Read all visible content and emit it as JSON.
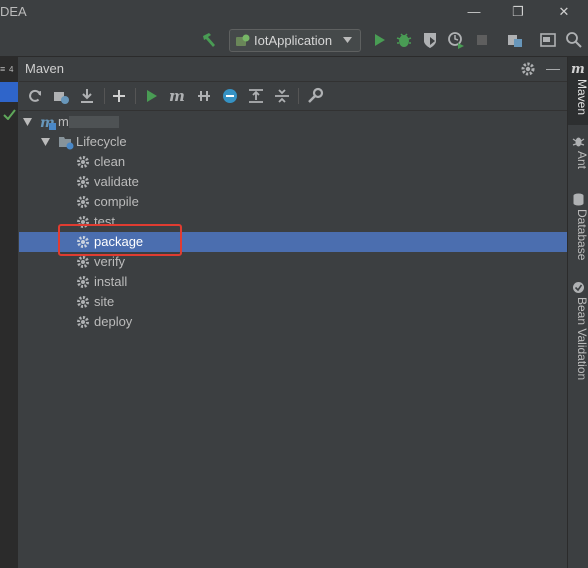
{
  "window": {
    "title": "DEA",
    "minimize": "—",
    "restore": "❐",
    "close": "✕"
  },
  "toolbar": {
    "run_config": "IotApplication"
  },
  "left_strip": {
    "badge": "4"
  },
  "maven": {
    "title": "Maven",
    "project": "m",
    "lifecycle_label": "Lifecycle",
    "phases": [
      "clean",
      "validate",
      "compile",
      "test",
      "package",
      "verify",
      "install",
      "site",
      "deploy"
    ],
    "selected": "package"
  },
  "right_tabs": {
    "maven": "Maven",
    "ant": "Ant",
    "database": "Database",
    "bean_validation": "Bean Validation"
  },
  "colors": {
    "selection": "#4b6eaf",
    "run_green": "#499c54",
    "highlight_red": "#e03c31"
  }
}
